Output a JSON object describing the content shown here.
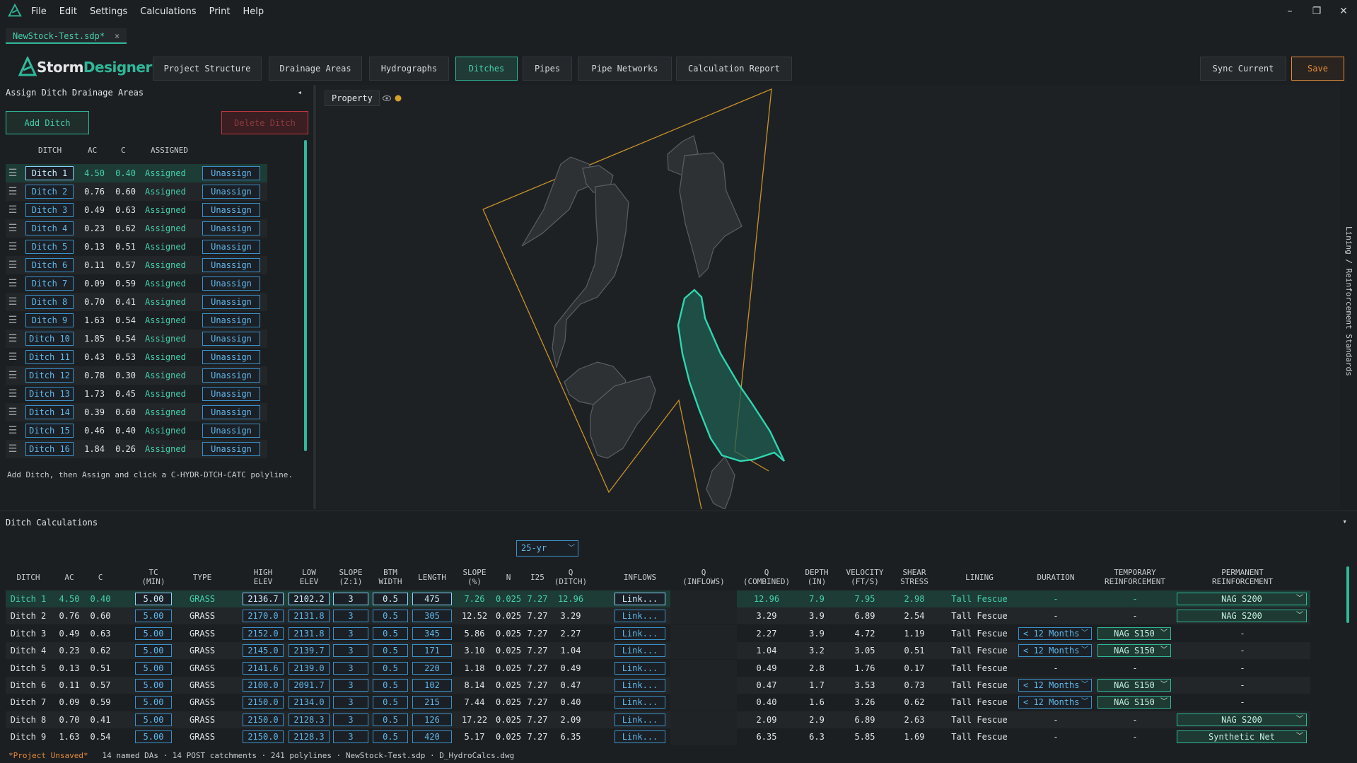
{
  "menu": [
    "File",
    "Edit",
    "Settings",
    "Calculations",
    "Print",
    "Help"
  ],
  "window_controls": [
    "–",
    "❐",
    "✕"
  ],
  "file_tab": {
    "name": "NewStock-Test.sdp*",
    "close": "×"
  },
  "brand": {
    "part1": "Storm",
    "part2": "Designer"
  },
  "nav": [
    "Project Structure",
    "Drainage Areas",
    "Hydrographs",
    "Ditches",
    "Pipes",
    "Pipe Networks",
    "Calculation Report"
  ],
  "nav_active": "Ditches",
  "actions": {
    "sync": "Sync Current",
    "save": "Save"
  },
  "left_panel": {
    "title": "Assign Ditch Drainage Areas",
    "collapse": "◂",
    "add": "Add Ditch",
    "delete": "Delete Ditch",
    "headers": [
      "DITCH",
      "AC",
      "C",
      "ASSIGNED"
    ],
    "rows": [
      {
        "name": "Ditch 1",
        "ac": "4.50",
        "c": "0.40",
        "status": "Assigned",
        "action": "Unassign"
      },
      {
        "name": "Ditch 2",
        "ac": "0.76",
        "c": "0.60",
        "status": "Assigned",
        "action": "Unassign"
      },
      {
        "name": "Ditch 3",
        "ac": "0.49",
        "c": "0.63",
        "status": "Assigned",
        "action": "Unassign"
      },
      {
        "name": "Ditch 4",
        "ac": "0.23",
        "c": "0.62",
        "status": "Assigned",
        "action": "Unassign"
      },
      {
        "name": "Ditch 5",
        "ac": "0.13",
        "c": "0.51",
        "status": "Assigned",
        "action": "Unassign"
      },
      {
        "name": "Ditch 6",
        "ac": "0.11",
        "c": "0.57",
        "status": "Assigned",
        "action": "Unassign"
      },
      {
        "name": "Ditch 7",
        "ac": "0.09",
        "c": "0.59",
        "status": "Assigned",
        "action": "Unassign"
      },
      {
        "name": "Ditch 8",
        "ac": "0.70",
        "c": "0.41",
        "status": "Assigned",
        "action": "Unassign"
      },
      {
        "name": "Ditch 9",
        "ac": "1.63",
        "c": "0.54",
        "status": "Assigned",
        "action": "Unassign"
      },
      {
        "name": "Ditch 10",
        "ac": "1.85",
        "c": "0.54",
        "status": "Assigned",
        "action": "Unassign"
      },
      {
        "name": "Ditch 11",
        "ac": "0.43",
        "c": "0.53",
        "status": "Assigned",
        "action": "Unassign"
      },
      {
        "name": "Ditch 12",
        "ac": "0.78",
        "c": "0.30",
        "status": "Assigned",
        "action": "Unassign"
      },
      {
        "name": "Ditch 13",
        "ac": "1.73",
        "c": "0.45",
        "status": "Assigned",
        "action": "Unassign"
      },
      {
        "name": "Ditch 14",
        "ac": "0.39",
        "c": "0.60",
        "status": "Assigned",
        "action": "Unassign"
      },
      {
        "name": "Ditch 15",
        "ac": "0.46",
        "c": "0.40",
        "status": "Assigned",
        "action": "Unassign"
      },
      {
        "name": "Ditch 16",
        "ac": "1.84",
        "c": "0.26",
        "status": "Assigned",
        "action": "Unassign"
      }
    ],
    "hint": "Add Ditch, then Assign and click a C-HYDR-DTCH-CATC polyline."
  },
  "map": {
    "property": "Property",
    "eye_icon": "eye-icon",
    "dot_color": "#d4a12a"
  },
  "right_tab": "Lining / Reinforcement Standards",
  "calc": {
    "title": "Ditch Calculations",
    "toggle": "▾",
    "storm": "25-yr",
    "headers": [
      [
        "DITCH"
      ],
      [
        "AC"
      ],
      [
        "C"
      ],
      [
        "TC",
        "(MIN)"
      ],
      [
        "TYPE"
      ],
      [
        "HIGH",
        "ELEV"
      ],
      [
        "LOW",
        "ELEV"
      ],
      [
        "SLOPE",
        "(Z:1)"
      ],
      [
        "BTM",
        "WIDTH"
      ],
      [
        "LENGTH"
      ],
      [
        "SLOPE",
        "(%)"
      ],
      [
        "N"
      ],
      [
        "I25"
      ],
      [
        "Q",
        "(DITCH)"
      ],
      [
        "INFLOWS"
      ],
      [
        "Q",
        "(INFLOWS)"
      ],
      [
        "Q",
        "(COMBINED)"
      ],
      [
        "DEPTH",
        "(IN)"
      ],
      [
        "VELOCITY",
        "(FT/S)"
      ],
      [
        "SHEAR",
        "STRESS"
      ],
      [
        "LINING"
      ],
      [
        "DURATION"
      ],
      [
        "TEMPORARY",
        "REINFORCEMENT"
      ],
      [
        "PERMANENT",
        "REINFORCEMENT"
      ]
    ],
    "rows": [
      {
        "ditch": "Ditch 1",
        "ac": "4.50",
        "c": "0.40",
        "tc": "5.00",
        "type": "GRASS",
        "high": "2136.7",
        "low": "2102.2",
        "z": "3",
        "btm": "0.5",
        "len": "475",
        "slope": "7.26",
        "n": "0.025",
        "i": "7.27",
        "q": "12.96",
        "inflows": "Link...",
        "qin": "",
        "qc": "12.96",
        "depth": "7.9",
        "vel": "7.95",
        "shear": "2.98",
        "lining": "Tall Fescue",
        "dur": "-",
        "temp": "-",
        "perm": "NAG S200"
      },
      {
        "ditch": "Ditch 2",
        "ac": "0.76",
        "c": "0.60",
        "tc": "5.00",
        "type": "GRASS",
        "high": "2170.0",
        "low": "2131.8",
        "z": "3",
        "btm": "0.5",
        "len": "305",
        "slope": "12.52",
        "n": "0.025",
        "i": "7.27",
        "q": "3.29",
        "inflows": "Link...",
        "qin": "",
        "qc": "3.29",
        "depth": "3.9",
        "vel": "6.89",
        "shear": "2.54",
        "lining": "Tall Fescue",
        "dur": "-",
        "temp": "-",
        "perm": "NAG S200"
      },
      {
        "ditch": "Ditch 3",
        "ac": "0.49",
        "c": "0.63",
        "tc": "5.00",
        "type": "GRASS",
        "high": "2152.0",
        "low": "2131.8",
        "z": "3",
        "btm": "0.5",
        "len": "345",
        "slope": "5.86",
        "n": "0.025",
        "i": "7.27",
        "q": "2.27",
        "inflows": "Link...",
        "qin": "",
        "qc": "2.27",
        "depth": "3.9",
        "vel": "4.72",
        "shear": "1.19",
        "lining": "Tall Fescue",
        "dur": "< 12 Months",
        "temp": "NAG S150",
        "perm": "-"
      },
      {
        "ditch": "Ditch 4",
        "ac": "0.23",
        "c": "0.62",
        "tc": "5.00",
        "type": "GRASS",
        "high": "2145.0",
        "low": "2139.7",
        "z": "3",
        "btm": "0.5",
        "len": "171",
        "slope": "3.10",
        "n": "0.025",
        "i": "7.27",
        "q": "1.04",
        "inflows": "Link...",
        "qin": "",
        "qc": "1.04",
        "depth": "3.2",
        "vel": "3.05",
        "shear": "0.51",
        "lining": "Tall Fescue",
        "dur": "< 12 Months",
        "temp": "NAG S150",
        "perm": "-"
      },
      {
        "ditch": "Ditch 5",
        "ac": "0.13",
        "c": "0.51",
        "tc": "5.00",
        "type": "GRASS",
        "high": "2141.6",
        "low": "2139.0",
        "z": "3",
        "btm": "0.5",
        "len": "220",
        "slope": "1.18",
        "n": "0.025",
        "i": "7.27",
        "q": "0.49",
        "inflows": "Link...",
        "qin": "",
        "qc": "0.49",
        "depth": "2.8",
        "vel": "1.76",
        "shear": "0.17",
        "lining": "Tall Fescue",
        "dur": "-",
        "temp": "-",
        "perm": "-"
      },
      {
        "ditch": "Ditch 6",
        "ac": "0.11",
        "c": "0.57",
        "tc": "5.00",
        "type": "GRASS",
        "high": "2100.0",
        "low": "2091.7",
        "z": "3",
        "btm": "0.5",
        "len": "102",
        "slope": "8.14",
        "n": "0.025",
        "i": "7.27",
        "q": "0.47",
        "inflows": "Link...",
        "qin": "",
        "qc": "0.47",
        "depth": "1.7",
        "vel": "3.53",
        "shear": "0.73",
        "lining": "Tall Fescue",
        "dur": "< 12 Months",
        "temp": "NAG S150",
        "perm": "-"
      },
      {
        "ditch": "Ditch 7",
        "ac": "0.09",
        "c": "0.59",
        "tc": "5.00",
        "type": "GRASS",
        "high": "2150.0",
        "low": "2134.0",
        "z": "3",
        "btm": "0.5",
        "len": "215",
        "slope": "7.44",
        "n": "0.025",
        "i": "7.27",
        "q": "0.40",
        "inflows": "Link...",
        "qin": "",
        "qc": "0.40",
        "depth": "1.6",
        "vel": "3.26",
        "shear": "0.62",
        "lining": "Tall Fescue",
        "dur": "< 12 Months",
        "temp": "NAG S150",
        "perm": "-"
      },
      {
        "ditch": "Ditch 8",
        "ac": "0.70",
        "c": "0.41",
        "tc": "5.00",
        "type": "GRASS",
        "high": "2150.0",
        "low": "2128.3",
        "z": "3",
        "btm": "0.5",
        "len": "126",
        "slope": "17.22",
        "n": "0.025",
        "i": "7.27",
        "q": "2.09",
        "inflows": "Link...",
        "qin": "",
        "qc": "2.09",
        "depth": "2.9",
        "vel": "6.89",
        "shear": "2.63",
        "lining": "Tall Fescue",
        "dur": "-",
        "temp": "-",
        "perm": "NAG S200"
      },
      {
        "ditch": "Ditch 9",
        "ac": "1.63",
        "c": "0.54",
        "tc": "5.00",
        "type": "GRASS",
        "high": "2150.0",
        "low": "2128.3",
        "z": "3",
        "btm": "0.5",
        "len": "420",
        "slope": "5.17",
        "n": "0.025",
        "i": "7.27",
        "q": "6.35",
        "inflows": "Link...",
        "qin": "",
        "qc": "6.35",
        "depth": "6.3",
        "vel": "5.85",
        "shear": "1.69",
        "lining": "Tall Fescue",
        "dur": "-",
        "temp": "-",
        "perm": "Synthetic Net"
      }
    ]
  },
  "status": {
    "unsaved": "*Project Unsaved*",
    "info": "14 named DAs · 14 POST catchments · 241 polylines  ·  NewStock-Test.sdp  ·  D_HydroCalcs.dwg"
  },
  "colors": {
    "accent": "#2fb89a",
    "link": "#5fb7ea",
    "danger": "#c23a3f",
    "save": "#e38a3a",
    "boundary": "#c8922a"
  }
}
